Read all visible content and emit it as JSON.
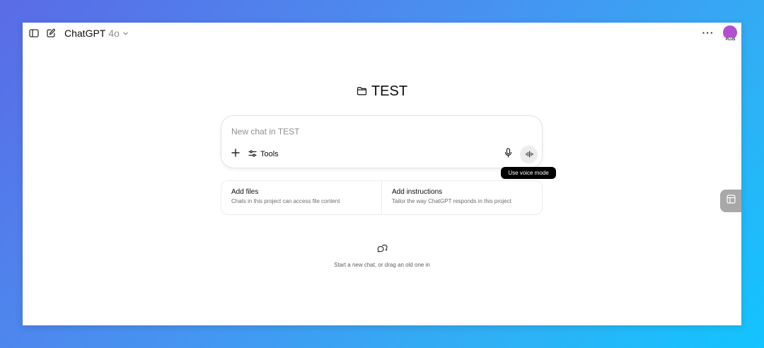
{
  "header": {
    "model_name": "ChatGPT",
    "model_version": "4o",
    "more_label": "···",
    "plan_badge": "PLUS",
    "avatar_color": "#b24fcf"
  },
  "project": {
    "title": "TEST",
    "icon": "folder-icon"
  },
  "composer": {
    "placeholder": "New chat in TEST",
    "value": "",
    "tools_label": "Tools",
    "voice_tooltip": "Use voice mode"
  },
  "cards": [
    {
      "title": "Add files",
      "description": "Chats in this project can access file content"
    },
    {
      "title": "Add instructions",
      "description": "Tailor the way ChatGPT responds in this project"
    }
  ],
  "empty_state": {
    "icon": "chat-bubbles-icon",
    "text": "Start a new chat, or drag an old one in"
  },
  "icons": {
    "sidebar": "sidebar-toggle-icon",
    "new_chat": "compose-icon",
    "dropdown": "chevron-down-icon",
    "add": "plus-icon",
    "tools": "sliders-icon",
    "mic": "microphone-icon",
    "voice": "waveform-icon",
    "side_panel": "panel-layout-icon"
  },
  "colors": {
    "background_start": "#5a6be6",
    "background_end": "#12c4ff",
    "tooltip": "#000000",
    "voice_button": "#ececec"
  }
}
